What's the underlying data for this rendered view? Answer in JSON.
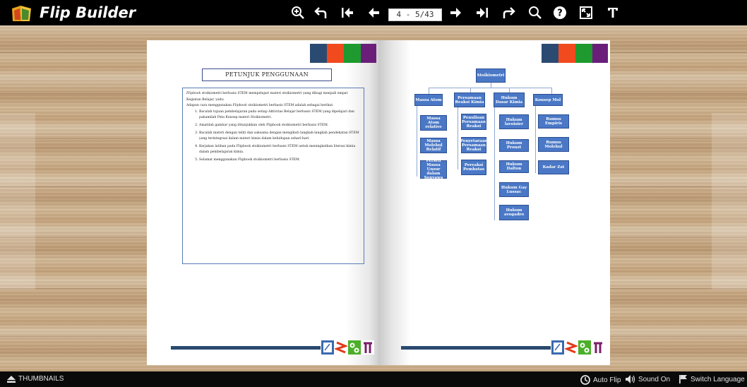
{
  "app": {
    "brand": "Flip Builder"
  },
  "toolbar": {
    "page_indicator": "4 - 5/43",
    "tools": [
      "zoom-in-icon",
      "back-icon",
      "first-page-icon",
      "prev-page-icon",
      "next-page-icon",
      "last-page-icon",
      "share-icon",
      "search-icon",
      "help-icon",
      "fullscreen-icon",
      "text-icon"
    ]
  },
  "left_page": {
    "title": "PETUNJUK PENGGUNAAN",
    "intro_italic": "Flipbook",
    "intro_rest": " stoikiometri berbasis STEM mempelajari materi stoikiometri yang dibagi menjadi empat Kegiatan Belajar, yaitu",
    "usage_pre": "Adapun cara menggunakan ",
    "usage_italic": "Flipbook",
    "usage_post": " stoikiometri berbasis STEM adalah sebagai berikut.",
    "steps": [
      "Bacalah tujuan pembelajaran pada setiap Aktivitas Belajar berbasis STEM yang dipelajari dan pahamilah Peta Konsep materi Stoikiometri.",
      "Amatilah gambar yang ditunjukkan oleh Flipbook stoikiometri berbasis STEM.",
      "Bacalah materi dengan teliti dan saksama dengan mengikuti langkah-langkah pendekatan STEM yang terintegrasi dalam materi kimia dalam kehidupan sehari-hari.",
      "Kerjakan latihan pada Flipbook stoikiometri berbasis STEM untuk meningkatkan literasi kimia dalam pembelajaran kimia.",
      "Selamat menggunakan Flipbook stoikiometri berbasis STEM."
    ]
  },
  "concept_map": {
    "root": "Stoikiometri",
    "col1": {
      "head": "Massa Atom",
      "items": [
        "Massa Atom relative",
        "Massa Molekul Relatif",
        "Persen Massa Unsur dalam Senyawa"
      ]
    },
    "col2": {
      "head": "Persamaan Reaksi Kimia",
      "items": [
        "Penulisan Persamaan Reaksi",
        "Penyetaraan Persamaan Reaksi",
        "Pereaksi Pembatas"
      ]
    },
    "col3": {
      "head": "Hukum Dasar Kimia",
      "items": [
        "Hukum lavoisier",
        "Hukum Proust",
        "Hukum Dalton",
        "Hukum Gay Lussac",
        "Hukum avogadro"
      ]
    },
    "col4": {
      "head": "Konsep Mol",
      "items": [
        "Rumus Empiris",
        "Rumus Molekul",
        "Kadar Zat"
      ]
    }
  },
  "colors": {
    "sq1": "#2b4a72",
    "sq2": "#f04a1e",
    "sq3": "#1e9a2e",
    "sq4": "#6a1e7a",
    "node": "#4a78c6"
  },
  "bottom": {
    "thumbnails": "THUMBNAILS",
    "auto_flip": "Auto Flip",
    "sound": "Sound On",
    "language": "Switch Language"
  }
}
